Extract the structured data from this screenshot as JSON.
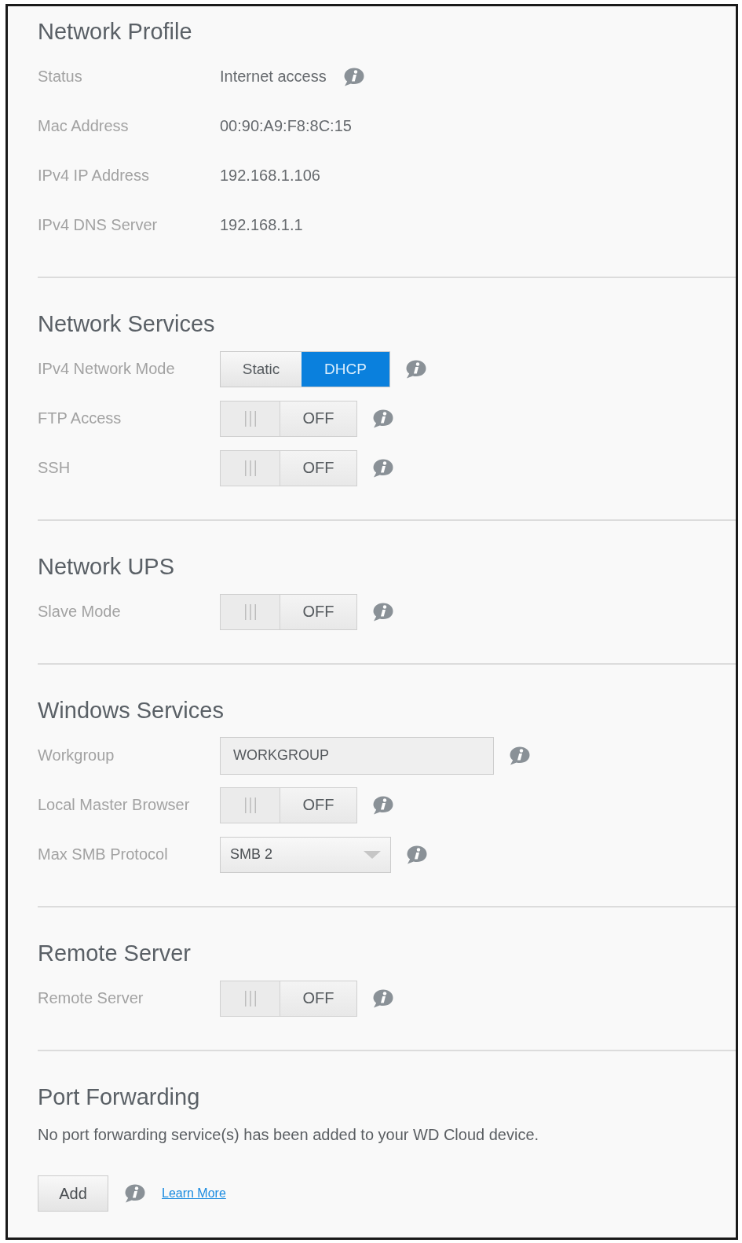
{
  "sections": [
    {
      "title": "Network Profile",
      "rows": [
        {
          "kind": "text",
          "label": "Status",
          "value": "Internet access",
          "info": true
        },
        {
          "kind": "text",
          "label": "Mac Address",
          "value": "00:90:A9:F8:8C:15"
        },
        {
          "kind": "text",
          "label": "IPv4 IP Address",
          "value": "192.168.1.106"
        },
        {
          "kind": "text",
          "label": "IPv4 DNS Server",
          "value": "192.168.1.1"
        }
      ]
    },
    {
      "title": "Network Services",
      "rows": [
        {
          "kind": "segmented",
          "label": "IPv4 Network Mode",
          "options": [
            {
              "label": "Static",
              "selected": false
            },
            {
              "label": "DHCP",
              "selected": true
            }
          ],
          "info": true
        },
        {
          "kind": "toggle",
          "label": "FTP Access",
          "on": false,
          "state_label": "OFF",
          "info": true
        },
        {
          "kind": "toggle",
          "label": "SSH",
          "on": false,
          "state_label": "OFF",
          "info": true
        }
      ]
    },
    {
      "title": "Network UPS",
      "rows": [
        {
          "kind": "toggle",
          "label": "Slave Mode",
          "on": false,
          "state_label": "OFF",
          "info": true
        }
      ]
    },
    {
      "title": "Windows Services",
      "rows": [
        {
          "kind": "input",
          "label": "Workgroup",
          "value": "WORKGROUP",
          "info": true
        },
        {
          "kind": "toggle",
          "label": "Local Master Browser",
          "on": false,
          "state_label": "OFF",
          "info": true
        },
        {
          "kind": "select",
          "label": "Max SMB Protocol",
          "value": "SMB 2",
          "info": true
        }
      ]
    },
    {
      "title": "Remote Server",
      "rows": [
        {
          "kind": "toggle",
          "label": "Remote Server",
          "on": false,
          "state_label": "OFF",
          "info": true
        }
      ]
    },
    {
      "title": "Port Forwarding",
      "message": "No port forwarding service(s) has been added to your WD Cloud device.",
      "footer": {
        "button": "Add",
        "info": true,
        "link": "Learn More"
      }
    }
  ]
}
